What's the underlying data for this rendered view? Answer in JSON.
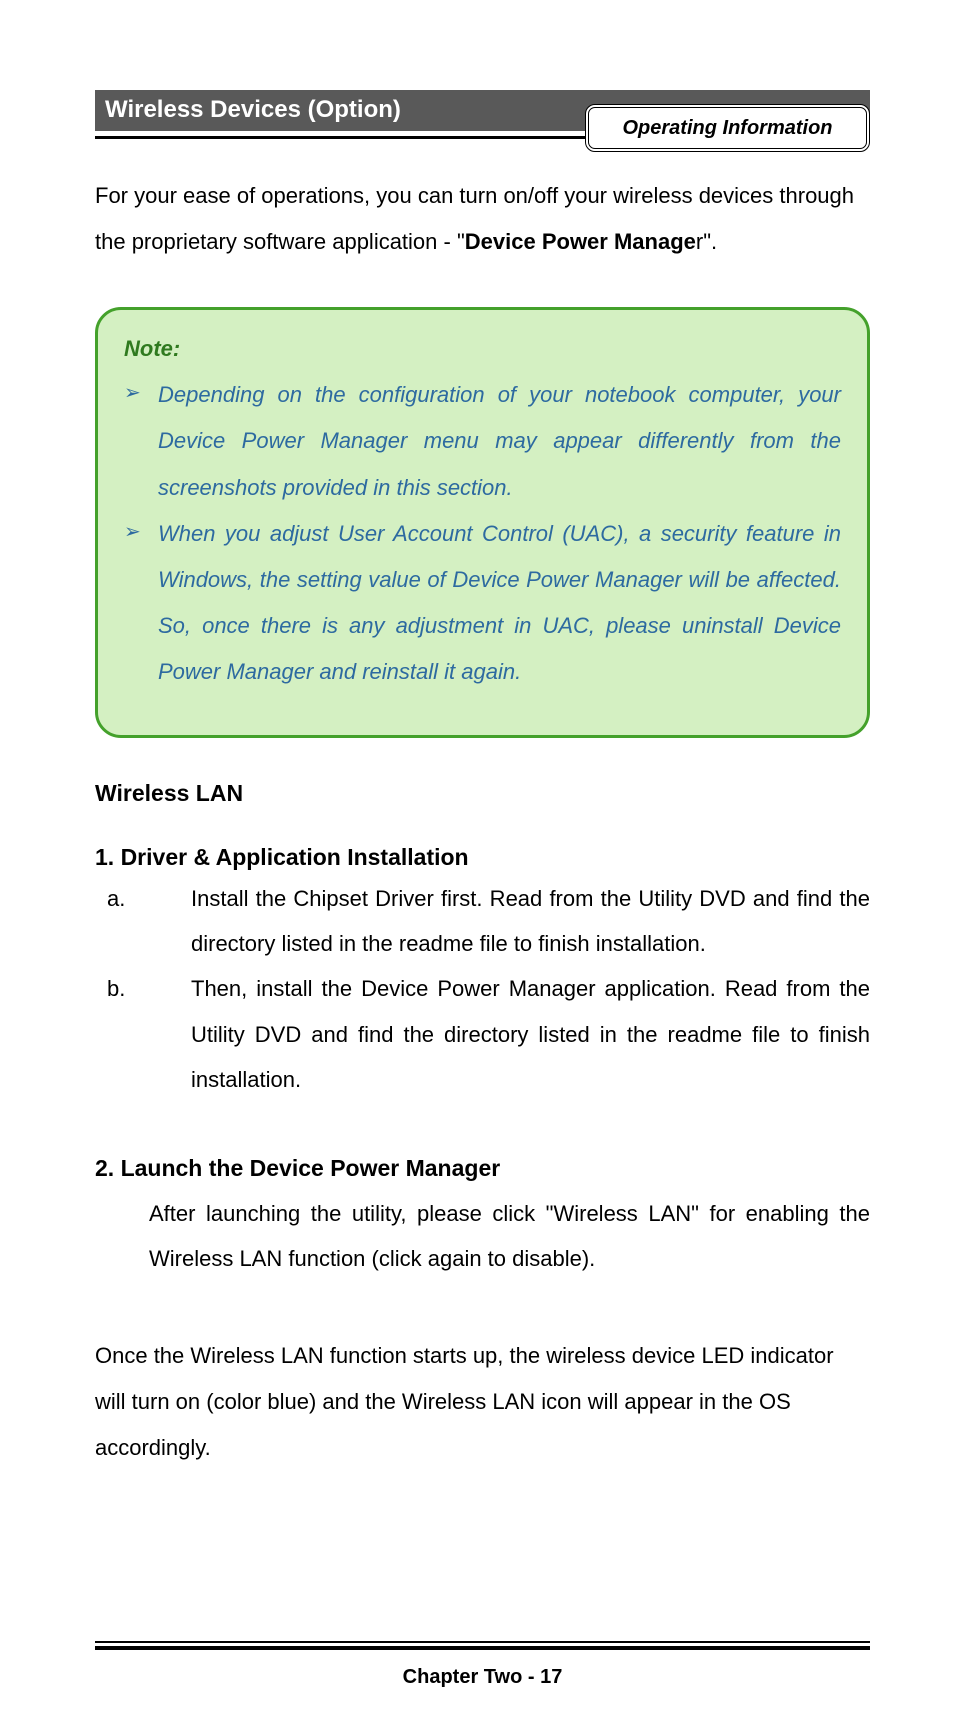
{
  "header": {
    "badge": "Operating Information"
  },
  "section_title": " Wireless Devices (Option)",
  "intro": {
    "pre": "For your ease of operations, you can turn on/off your wireless devices through the proprietary software application - \"",
    "bold": "Device Power Manage",
    "post": "r\"."
  },
  "note": {
    "title": "Note:",
    "items": [
      "Depending on the configuration of your notebook computer, your Device Power Manager menu may appear differently from the screenshots provided in this section.",
      "When you adjust User Account Control (UAC), a security feature in Windows, the setting value of Device Power Manager will be affected. So, once there is any adjustment in UAC, please uninstall Device Power Manager and reinstall it again."
    ]
  },
  "wlan_heading": "Wireless LAN",
  "step1": {
    "num_title": "1.    Driver & Application Installation",
    "a_label": "a.",
    "a_text": "Install the Chipset Driver first. Read from the Utility DVD and find the directory listed in the readme file to finish installation.",
    "b_label": "b.",
    "b_text": "Then, install the Device Power Manager application. Read from the Utility DVD and find the directory listed in the readme file to finish installation."
  },
  "step2": {
    "num_title": "2.    Launch the Device Power Manager",
    "body": "After launching the utility, please click \"Wireless LAN\" for enabling the Wireless LAN function (click again to disable)."
  },
  "conclusion": "Once the Wireless LAN function starts up, the wireless device LED indicator will turn on (color blue) and the Wireless LAN icon will appear in the OS accordingly.",
  "footer": "Chapter Two - 17"
}
